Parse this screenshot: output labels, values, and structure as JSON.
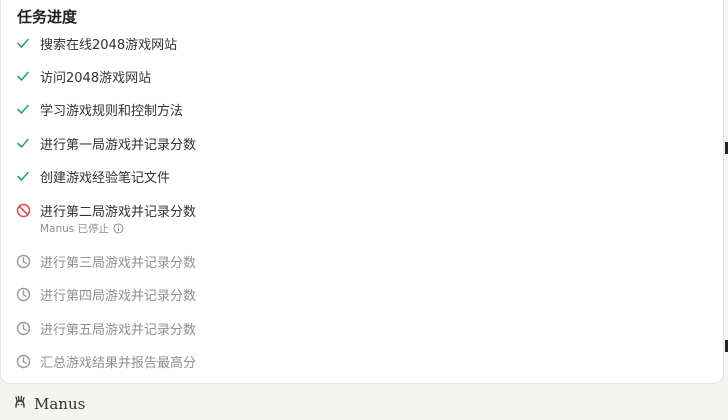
{
  "panel": {
    "title": "任务进度",
    "tasks": [
      {
        "label": "搜索在线2048游戏网站",
        "status": "done"
      },
      {
        "label": "访问2048游戏网站",
        "status": "done"
      },
      {
        "label": "学习游戏规则和控制方法",
        "status": "done"
      },
      {
        "label": "进行第一局游戏并记录分数",
        "status": "done"
      },
      {
        "label": "创建游戏经验笔记文件",
        "status": "done"
      },
      {
        "label": "进行第二局游戏并记录分数",
        "status": "stopped"
      },
      {
        "label": "进行第三局游戏并记录分数",
        "status": "pending"
      },
      {
        "label": "进行第四局游戏并记录分数",
        "status": "pending"
      },
      {
        "label": "进行第五局游戏并记录分数",
        "status": "pending"
      },
      {
        "label": "汇总游戏结果并报告最高分",
        "status": "pending"
      }
    ],
    "stopped_note": "Manus 已停止"
  },
  "footer": {
    "brand": "Manus"
  },
  "colors": {
    "done": "#2fa36b",
    "stopped": "#d94a4a",
    "pending": "#9a9a96"
  },
  "icons": {
    "done": "check-icon",
    "stopped": "prohibited-icon",
    "pending": "clock-icon",
    "info": "info-icon",
    "logo": "manus-logo-icon"
  }
}
